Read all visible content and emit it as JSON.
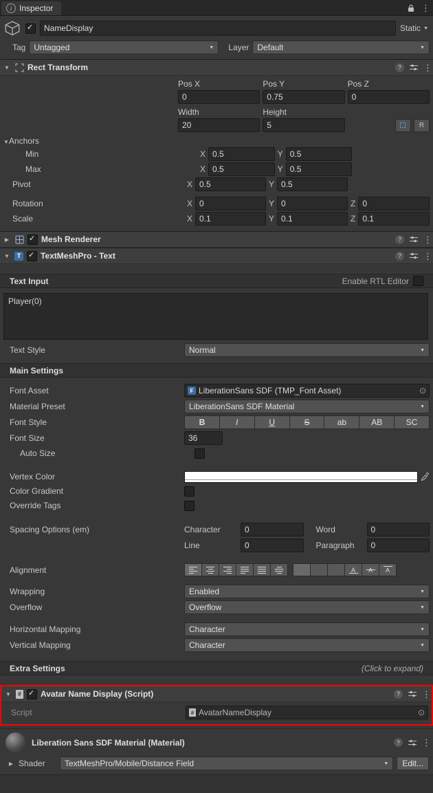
{
  "colors": {
    "background": "#383838",
    "component_header": "#3e3e3e",
    "field": "#2a2a2a",
    "script_highlight": "#ff0000"
  },
  "icons": {
    "inspector": "i",
    "kebab": "⋮",
    "help": "?",
    "fold_open": "▼",
    "fold_closed": "▶",
    "check": "✓",
    "dropdown_arrow": "▼",
    "picker": "⊙",
    "tmp_letter": "T",
    "font_asset_letter": "F",
    "script_hash": "#",
    "align_letter": "A"
  },
  "window": {
    "tab_label": "Inspector"
  },
  "gameobject": {
    "name": "NameDisplay",
    "static_label": "Static",
    "tag_label": "Tag",
    "tag_value": "Untagged",
    "layer_label": "Layer",
    "layer_value": "Default"
  },
  "rect_transform": {
    "title": "Rect Transform",
    "pos_x_label": "Pos X",
    "pos_y_label": "Pos Y",
    "pos_z_label": "Pos Z",
    "pos_x": "0",
    "pos_y": "0.75",
    "pos_z": "0",
    "width_label": "Width",
    "height_label": "Height",
    "width": "20",
    "height": "5",
    "anchors_label": "Anchors",
    "min_label": "Min",
    "max_label": "Max",
    "pivot_label": "Pivot",
    "axis_x": "X",
    "axis_y": "Y",
    "axis_z": "Z",
    "min_x": "0.5",
    "min_y": "0.5",
    "max_x": "0.5",
    "max_y": "0.5",
    "pivot_x": "0.5",
    "pivot_y": "0.5",
    "rotation_label": "Rotation",
    "rotation_x": "0",
    "rotation_y": "0",
    "rotation_z": "0",
    "scale_label": "Scale",
    "scale_x": "0.1",
    "scale_y": "0.1",
    "scale_z": "0.1",
    "raw_edit_label": "R"
  },
  "mesh_renderer": {
    "title": "Mesh Renderer"
  },
  "tmp": {
    "title": "TextMeshPro - Text",
    "text_input_label": "Text Input",
    "rtl_label": "Enable RTL Editor",
    "text_value": "Player(0)",
    "text_style_label": "Text Style",
    "text_style_value": "Normal",
    "main_settings_label": "Main Settings",
    "font_asset_label": "Font Asset",
    "font_asset_value": "LiberationSans SDF (TMP_Font Asset)",
    "material_preset_label": "Material Preset",
    "material_preset_value": "LiberationSans SDF Material",
    "font_style_label": "Font Style",
    "font_style_buttons": [
      "B",
      "I",
      "U",
      "S",
      "ab",
      "AB",
      "SC"
    ],
    "font_size_label": "Font Size",
    "font_size_value": "36",
    "auto_size_label": "Auto Size",
    "vertex_color_label": "Vertex Color",
    "vertex_color_value": "#ffffff",
    "color_gradient_label": "Color Gradient",
    "override_tags_label": "Override Tags",
    "spacing_label": "Spacing Options (em)",
    "character_label": "Character",
    "character_value": "0",
    "word_label": "Word",
    "word_value": "0",
    "line_label": "Line",
    "line_value": "0",
    "paragraph_label": "Paragraph",
    "paragraph_value": "0",
    "alignment_label": "Alignment",
    "wrapping_label": "Wrapping",
    "wrapping_value": "Enabled",
    "overflow_label": "Overflow",
    "overflow_value": "Overflow",
    "horizontal_mapping_label": "Horizontal Mapping",
    "horizontal_mapping_value": "Character",
    "vertical_mapping_label": "Vertical Mapping",
    "vertical_mapping_value": "Character",
    "extra_settings_label": "Extra Settings",
    "extra_settings_hint": "(Click to expand)"
  },
  "script_component": {
    "title": "Avatar Name Display (Script)",
    "script_label": "Script",
    "script_value": "AvatarNameDisplay"
  },
  "material": {
    "title": "Liberation Sans SDF Material (Material)",
    "shader_label": "Shader",
    "shader_value": "TextMeshPro/Mobile/Distance Field",
    "edit_label": "Edit..."
  }
}
